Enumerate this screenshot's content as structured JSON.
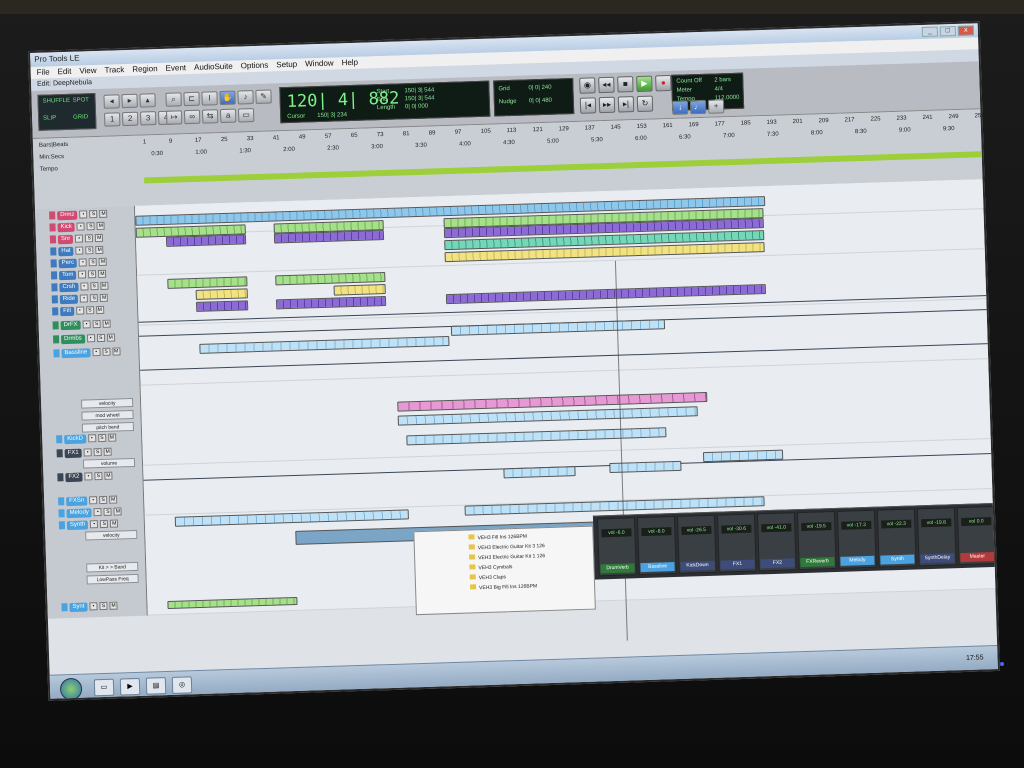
{
  "window": {
    "app_title": "Pro Tools LE",
    "edit_title": "Edit: DeepNebula",
    "buttons": [
      "_",
      "□",
      "x"
    ]
  },
  "menu": [
    "File",
    "Edit",
    "View",
    "Track",
    "Region",
    "Event",
    "AudioSuite",
    "Options",
    "Setup",
    "Window",
    "Help"
  ],
  "toolbar": {
    "mode": {
      "shuffle": "SHUFFLE",
      "slip": "SLIP",
      "spot": "SPOT",
      "grid": "GRID"
    },
    "main_counter": "120| 4| 882",
    "cursor_label": "Cursor",
    "cursor_value": "150| 3| 234",
    "start_label": "Start",
    "end_label": "End",
    "length_label": "Length",
    "start_value": "150| 3| 544",
    "end_value": "150| 3| 544",
    "length_value": "0| 0| 000",
    "grid_label": "Grid",
    "nudge_label": "Nudge",
    "grid_value": "0| 0| 240",
    "nudge_value": "0| 0| 480",
    "count_off": "Count Off",
    "meter_label": "Meter",
    "tempo_label": "Tempo",
    "count_value": "2 bars",
    "meter_value": "4/4",
    "tempo_value": "112.0000"
  },
  "rulers": {
    "labels": [
      "Bars|Beats",
      "Min:Secs",
      "Tempo"
    ],
    "bars": [
      "1",
      "9",
      "17",
      "25",
      "33",
      "41",
      "49",
      "57",
      "65",
      "73",
      "81",
      "89",
      "97",
      "105",
      "113",
      "121",
      "129",
      "137",
      "145",
      "153",
      "161",
      "169",
      "177",
      "185",
      "193",
      "201",
      "209",
      "217",
      "225",
      "233",
      "241",
      "249",
      "257"
    ],
    "mins": [
      "0:30",
      "1:00",
      "1:30",
      "2:00",
      "2:30",
      "3:00",
      "3:30",
      "4:00",
      "4:30",
      "5:00",
      "5:30",
      "6:00",
      "6:30",
      "7:00",
      "7:30",
      "8:00",
      "8:30",
      "9:00",
      "9:30"
    ]
  },
  "tracks": [
    {
      "name": "Drmz",
      "color": "#d14a72"
    },
    {
      "name": "Kick",
      "color": "#d14a72"
    },
    {
      "name": "Snr",
      "color": "#d14a72"
    },
    {
      "name": "Hat",
      "color": "#3d7abf"
    },
    {
      "name": "Perc",
      "color": "#3d7abf"
    },
    {
      "name": "Tom",
      "color": "#3d7abf"
    },
    {
      "name": "Crsh",
      "color": "#3d7abf"
    },
    {
      "name": "Ride",
      "color": "#3d7abf"
    },
    {
      "name": "Fill",
      "color": "#3d7abf"
    },
    {
      "name": "DrFX",
      "color": "#2f8f5c"
    },
    {
      "name": "Drmbs",
      "color": "#2f8f5c"
    },
    {
      "name": "Bassline",
      "color": "#4aa3e0"
    },
    {
      "name": "KickD",
      "color": "#4aa3e0"
    },
    {
      "name": "FX1",
      "color": "#3b4654"
    },
    {
      "name": "FX2",
      "color": "#3b4654"
    },
    {
      "name": "FXSn",
      "color": "#4aa3e0"
    },
    {
      "name": "Melody",
      "color": "#4aa3e0"
    },
    {
      "name": "Synth",
      "color": "#4aa3e0"
    },
    {
      "name": "Synt",
      "color": "#4aa3e0"
    }
  ],
  "params": {
    "velocity": "velocity",
    "mod": "mod wheel",
    "pitch": "pitch bend",
    "volume": "volume",
    "kit": "Kit > > Band",
    "lowpass": "LowPass Freq"
  },
  "mixer": {
    "strips": [
      {
        "vol": "vol -6.0",
        "name": "DrumVerb",
        "color": "#2f7a3a"
      },
      {
        "vol": "vol -8.0",
        "name": "Bassline",
        "color": "#4aa3e0"
      },
      {
        "vol": "vol -26.5",
        "name": "KickDown",
        "color": "#3d4c7a"
      },
      {
        "vol": "vol -30.6",
        "name": "FX1",
        "color": "#3d4c7a"
      },
      {
        "vol": "vol -41.0",
        "name": "FX2",
        "color": "#3d4c7a"
      },
      {
        "vol": "vol -19.5",
        "name": "FXReverb",
        "color": "#2f7a3a"
      },
      {
        "vol": "vol -17.3",
        "name": "Melody",
        "color": "#4aa3e0"
      },
      {
        "vol": "vol -22.3",
        "name": "Synth",
        "color": "#4aa3e0"
      },
      {
        "vol": "vol -19.8",
        "name": "SynthDelay",
        "color": "#3d4c7a"
      },
      {
        "vol": "vol 0.0",
        "name": "Master",
        "color": "#b33a3a"
      }
    ]
  },
  "browser": {
    "items": [
      "VEH3 Fill Ins 126BPM",
      "VEH3 Electric Guitar Kit 3 126",
      "VEH3 Electric Guitar Kit 1 126",
      "VEH3 Cymbals",
      "VEH3 Claps",
      "VEH3 Big Fill Ins 126BPM"
    ]
  },
  "taskbar": {
    "clock": "17:55"
  }
}
